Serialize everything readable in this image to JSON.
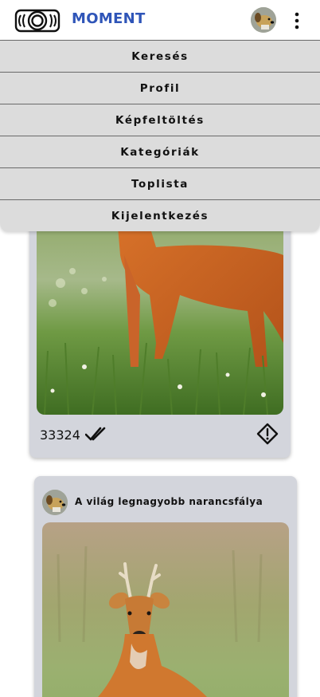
{
  "header": {
    "brand": "MOMENT",
    "logo_icon": "camera-lens-icon",
    "avatar_icon": "dog-avatar-icon",
    "more_icon": "kebab-menu-icon"
  },
  "menu": {
    "items": [
      {
        "label": "Keresés"
      },
      {
        "label": "Profil"
      },
      {
        "label": "Képfeltöltés"
      },
      {
        "label": "Kategóriák"
      },
      {
        "label": "Toplista"
      },
      {
        "label": "Kijelentkezés"
      }
    ]
  },
  "posts": [
    {
      "image": "roe-deer-meadow-photo",
      "likes": "33324",
      "like_icon": "double-check-icon",
      "report_icon": "warning-diamond-icon"
    },
    {
      "title": "A világ legnagyobb narancsfálya",
      "avatar_icon": "dog-avatar-icon",
      "image": "roe-deer-buck-photo"
    }
  ],
  "colors": {
    "brand": "#2f55b8",
    "menu_bg": "#dcdcdc",
    "card_bg": "#d3d5dc"
  }
}
